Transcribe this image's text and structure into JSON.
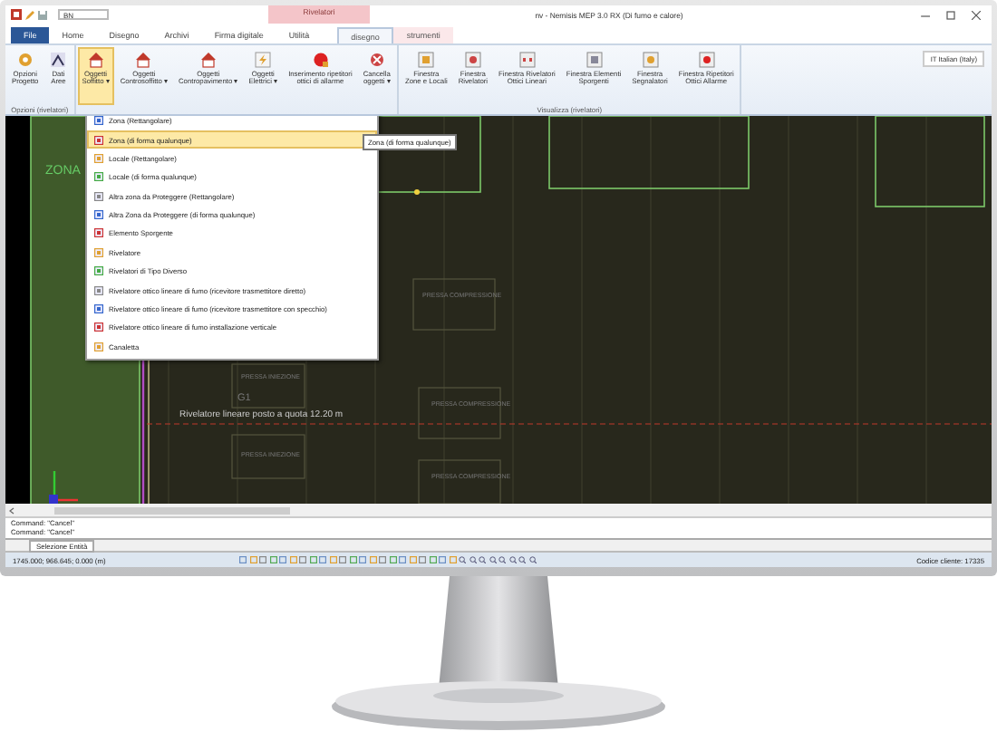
{
  "window": {
    "title": "nv - Nemisis MEP 3.0 RX (Di fumo e calore)",
    "quick_access_field": "BN",
    "context_group": "Rivelatori"
  },
  "tabs": [
    {
      "label": "File",
      "kind": "file",
      "selected": false
    },
    {
      "label": "Home",
      "kind": "normal",
      "selected": false
    },
    {
      "label": "Disegno",
      "kind": "normal",
      "selected": false
    },
    {
      "label": "Archivi",
      "kind": "normal",
      "selected": false
    },
    {
      "label": "Firma digitale",
      "kind": "normal",
      "selected": false
    },
    {
      "label": "Utilità",
      "kind": "normal",
      "selected": false
    },
    {
      "label": "disegno",
      "kind": "context",
      "selected": true
    },
    {
      "label": "strumenti",
      "kind": "context",
      "selected": false
    }
  ],
  "ribbon": {
    "groups": [
      {
        "label": "Opzioni (rivelatori)",
        "buttons": [
          {
            "label": "Opzioni\nProgetto",
            "selected": false
          },
          {
            "label": "Dati\nAree",
            "selected": false
          }
        ]
      },
      {
        "buttons": [
          {
            "label": "Oggetti\nSoffitto ▾",
            "selected": true
          },
          {
            "label": "Oggetti\nControsoffitto ▾",
            "selected": false
          },
          {
            "label": "Oggetti\nContropavimento ▾",
            "selected": false
          },
          {
            "label": "Oggetti\nElettrici ▾",
            "selected": false
          },
          {
            "label": "Inserimento ripetitori\nottici di allarme",
            "selected": false
          },
          {
            "label": "Cancella\noggetti ▾",
            "selected": false
          }
        ]
      },
      {
        "label": "Visualizza (rivelatori)",
        "buttons": [
          {
            "label": "Finestra\nZone e Locali",
            "selected": false
          },
          {
            "label": "Finestra\nRivelatori",
            "selected": false
          },
          {
            "label": "Finestra Rivelatori\nOttici Lineari",
            "selected": false
          },
          {
            "label": "Finestra Elementi\nSporgenti",
            "selected": false
          },
          {
            "label": "Finestra\nSegnalatori",
            "selected": false
          },
          {
            "label": "Finestra Ripetitori\nOttici Allarme",
            "selected": false
          }
        ]
      }
    ],
    "language": "IT Italian (Italy)"
  },
  "menu": {
    "items": [
      {
        "label": "Zona (Rettangolare)",
        "selected": false
      },
      {
        "label": "Zona (di forma qualunque)",
        "selected": true
      },
      {
        "label": "Locale (Rettangolare)",
        "selected": false
      },
      {
        "label": "Locale (di forma qualunque)",
        "selected": false
      },
      {
        "label": "Altra zona da Proteggere (Rettangolare)",
        "selected": false
      },
      {
        "label": "Altra Zona da Proteggere (di forma qualunque)",
        "selected": false
      },
      {
        "label": "Elemento Sporgente",
        "selected": false
      },
      {
        "label": "Rivelatore",
        "selected": false
      },
      {
        "label": "Rivelatori di Tipo Diverso",
        "selected": false
      },
      {
        "label": "Rivelatore ottico lineare di fumo (ricevitore trasmettitore diretto)",
        "selected": false
      },
      {
        "label": "Rivelatore ottico lineare di fumo (ricevitore trasmettitore con specchio)",
        "selected": false
      },
      {
        "label": "Rivelatore ottico lineare di fumo installazione verticale",
        "selected": false
      },
      {
        "label": "Canaletta",
        "selected": false
      }
    ],
    "tooltip": "Zona (di forma qualunque)"
  },
  "canvas": {
    "labels": [
      "ZONA",
      "PRESSA COMPRESSIONE",
      "PRESSA INIEZIONE",
      "G1",
      "PRESSA COMPRESSIONE",
      "Rivelatore lineare posto a quota 12.20 m",
      "PRESSA INIEZIONE",
      "PRESSA COMPRESSIONE"
    ]
  },
  "command_history": [
    "Command: \"Cancel\"",
    "Command: \"Cancel\""
  ],
  "selection_tab": "Selezione Entità",
  "status_bar": {
    "coordinates": "1745.000; 966.645; 0.000 (m)",
    "customer_code": "Codice cliente: 17335"
  }
}
